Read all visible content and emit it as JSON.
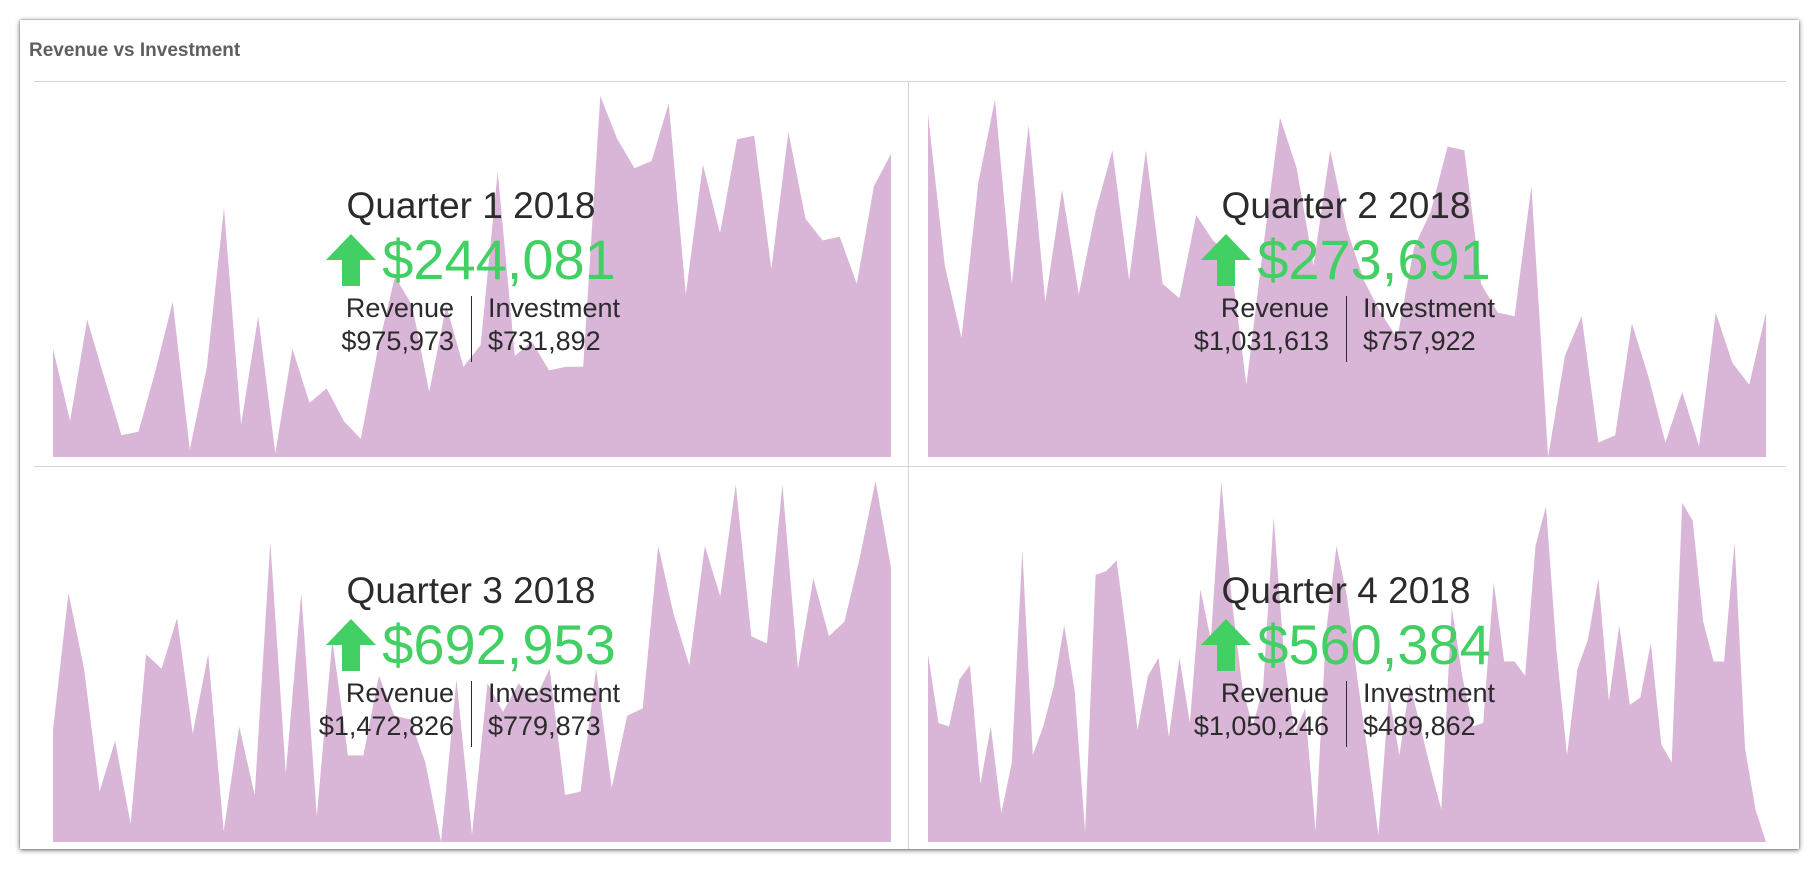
{
  "card": {
    "title": "Revenue vs Investment"
  },
  "colors": {
    "area_fill": "#d9b5d7",
    "positive": "#42cf63",
    "text": "#2b2b2b"
  },
  "icons": {
    "delta": "arrow-up-icon"
  },
  "tiles": [
    {
      "quarter": "Quarter 1 2018",
      "delta": "$244,081",
      "revenue_label": "Revenue",
      "revenue_value": "$975,973",
      "investment_label": "Investment",
      "investment_value": "$731,892"
    },
    {
      "quarter": "Quarter 2 2018",
      "delta": "$273,691",
      "revenue_label": "Revenue",
      "revenue_value": "$1,031,613",
      "investment_label": "Investment",
      "investment_value": "$757,922"
    },
    {
      "quarter": "Quarter 3 2018",
      "delta": "$692,953",
      "revenue_label": "Revenue",
      "revenue_value": "$1,472,826",
      "investment_label": "Investment",
      "investment_value": "$779,873"
    },
    {
      "quarter": "Quarter 4 2018",
      "delta": "$560,384",
      "revenue_label": "Revenue",
      "revenue_value": "$1,050,246",
      "investment_label": "Investment",
      "investment_value": "$489,862"
    }
  ],
  "chart_data": [
    {
      "type": "area",
      "ylim": [
        0,
        100
      ],
      "values": [
        30,
        10,
        38,
        22,
        6,
        7,
        24,
        43,
        2,
        25,
        69,
        9,
        39,
        1,
        30,
        15,
        19,
        10,
        5,
        30,
        50,
        42,
        18,
        42,
        25,
        31,
        79,
        28,
        32,
        24,
        25,
        25,
        100,
        88,
        80,
        82,
        98,
        45,
        81,
        62,
        88,
        89,
        52,
        90,
        66,
        60,
        61,
        48,
        75,
        84
      ]
    },
    {
      "type": "area",
      "ylim": [
        0,
        100
      ],
      "values": [
        95,
        53,
        33,
        76,
        99,
        48,
        92,
        43,
        74,
        45,
        68,
        85,
        49,
        85,
        48,
        44,
        67,
        60,
        56,
        20,
        58,
        94,
        80,
        53,
        85,
        63,
        49,
        40,
        33,
        58,
        68,
        86,
        85,
        48,
        40,
        39,
        75,
        0,
        28,
        39,
        4,
        6,
        37,
        22,
        4,
        18,
        3,
        40,
        26,
        20,
        40
      ]
    },
    {
      "type": "area",
      "ylim": [
        0,
        100
      ],
      "values": [
        31,
        69,
        48,
        14,
        28,
        5,
        52,
        48,
        62,
        30,
        52,
        3,
        32,
        13,
        83,
        19,
        69,
        7,
        56,
        24,
        24,
        46,
        35,
        34,
        22,
        0,
        45,
        2,
        44,
        36,
        44,
        39,
        48,
        13,
        14,
        48,
        15,
        35,
        37,
        82,
        63,
        49,
        82,
        68,
        99,
        57,
        55,
        99,
        48,
        73,
        57,
        61,
        79,
        100,
        76
      ]
    },
    {
      "type": "area",
      "ylim": [
        0,
        100
      ],
      "values": [
        52,
        33,
        32,
        45,
        49,
        16,
        32,
        8,
        22,
        81,
        24,
        32,
        43,
        60,
        42,
        3,
        74,
        75,
        78,
        56,
        31,
        46,
        51,
        29,
        51,
        33,
        70,
        56,
        100,
        67,
        43,
        32,
        43,
        90,
        51,
        30,
        37,
        3,
        58,
        82,
        68,
        45,
        24,
        2,
        41,
        24,
        44,
        32,
        20,
        9,
        65,
        46,
        32,
        33,
        72,
        50,
        50,
        46,
        82,
        93,
        53,
        24,
        48,
        56,
        73,
        39,
        60,
        38,
        40,
        55,
        27,
        22,
        94,
        89,
        61,
        50,
        50,
        83,
        26,
        9,
        0
      ]
    }
  ]
}
